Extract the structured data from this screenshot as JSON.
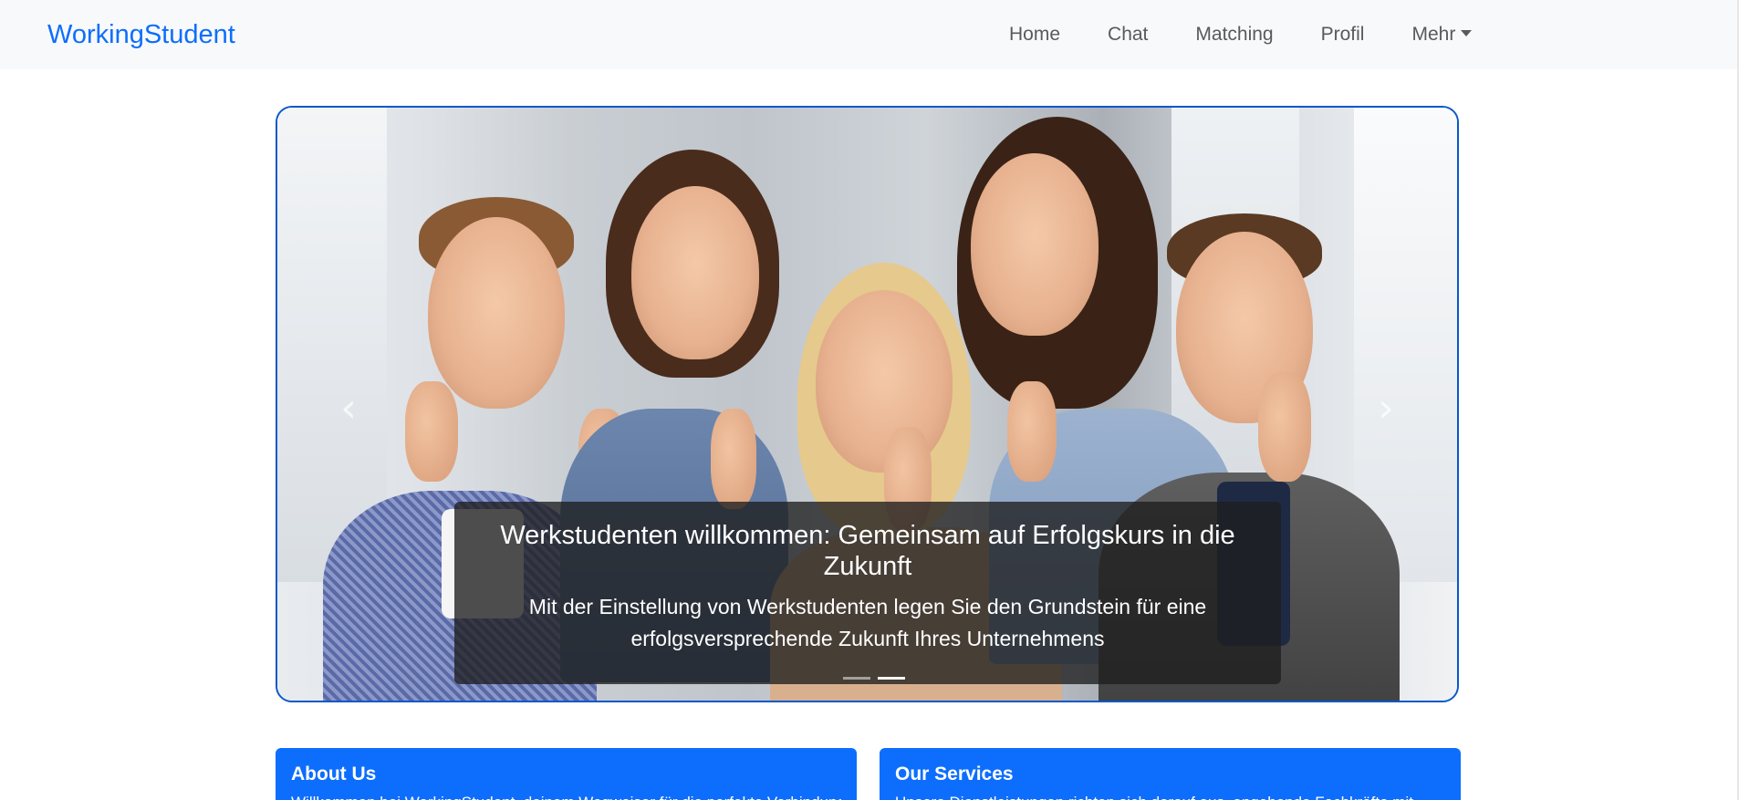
{
  "navbar": {
    "brand": "WorkingStudent",
    "links": [
      "Home",
      "Chat",
      "Matching",
      "Profil"
    ],
    "more_label": "Mehr"
  },
  "carousel": {
    "caption_title": "Werkstudenten willkommen: Gemeinsam auf Erfolgskurs in die Zukunft",
    "caption_text": "Mit der Einstellung von Werkstudenten legen Sie den Grundstein für eine erfolgsversprechende Zukunft Ihres Unternehmens",
    "prev_icon": "‹",
    "next_icon": "›",
    "slide_count": 2,
    "active_slide": 2
  },
  "cards": {
    "about": {
      "title": "About Us",
      "text": "Willkommen bei WorkingStudent, deinem Wegweiser für die perfekte Verbindung"
    },
    "services": {
      "title": "Our Services",
      "text": "Unsere Dienstleistungen richten sich darauf aus, angehende Fachkräfte mit"
    }
  },
  "colors": {
    "brand": "#0d6efd",
    "border": "#0a58ca",
    "navbar_bg": "#f8f9fa",
    "caption_bg": "rgba(30,30,30,0.78)"
  }
}
